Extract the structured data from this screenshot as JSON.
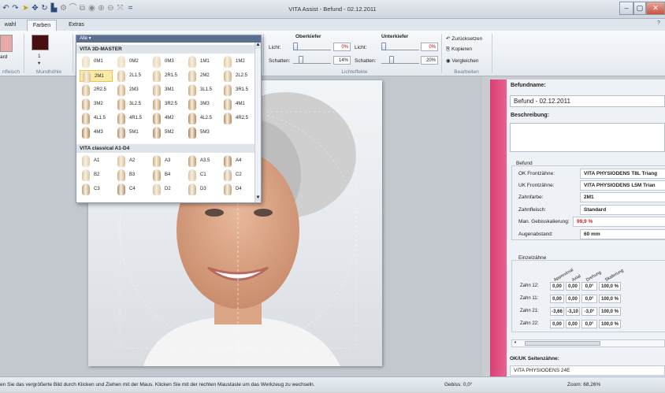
{
  "window": {
    "title": "VITA Assist - Befund - 02.12.2011",
    "buttons": {
      "minimize": "–",
      "maximize": "▢",
      "close": "✕"
    },
    "help_glyph": "?"
  },
  "quick_access": {
    "menu_glyph": "="
  },
  "tabs": [
    {
      "label": "wahl",
      "active": false
    },
    {
      "label": "Farben",
      "active": true
    },
    {
      "label": "Extras",
      "active": false
    }
  ],
  "ribbon": {
    "swatch_left_label": "ard",
    "mundhoehle_value": "1",
    "mundhoehle_arrow": "▾",
    "group_labels": {
      "left": "nfleisch",
      "mundhoehle": "Mundhöhle",
      "lichteffekte": "Lichteffekte",
      "bearbeiten": "Bearbeiten"
    },
    "oberkiefer": {
      "heading": "Oberkiefer",
      "licht_label": "Licht:",
      "licht_pct": "0%",
      "schatten_label": "Schatten:",
      "schatten_pct": "14%"
    },
    "unterkiefer": {
      "heading": "Unterkiefer",
      "licht_label": "Licht:",
      "licht_pct": "0%",
      "schatten_label": "Schatten:",
      "schatten_pct": "20%"
    },
    "bearbeiten": {
      "reset": "Zurücksetzen",
      "copy": "Kopieren",
      "compare": "Vergleichen"
    },
    "colors": {
      "swatch_gum": "#e7a8a8",
      "swatch_mouth": "#4a0e0e"
    }
  },
  "palette": {
    "header": "Alle ▾",
    "sections": [
      {
        "title": "VITA 3D-MASTER",
        "shades": [
          {
            "label": "0M1",
            "color": "#ecdcc3",
            "selected": false
          },
          {
            "label": "0M2",
            "color": "#eadac0",
            "selected": false
          },
          {
            "label": "0M3",
            "color": "#e6d4b8",
            "selected": false
          },
          {
            "label": "1M1",
            "color": "#e2cda8",
            "selected": false
          },
          {
            "label": "1M2",
            "color": "#e0c79c",
            "selected": false
          },
          {
            "label": "2M1",
            "color": "#dcc196",
            "selected": true
          },
          {
            "label": "2L1.5",
            "color": "#d9bc8f",
            "selected": false
          },
          {
            "label": "2R1.5",
            "color": "#d6b98d",
            "selected": false
          },
          {
            "label": "2M2",
            "color": "#d4b486",
            "selected": false
          },
          {
            "label": "2L2.5",
            "color": "#d2b07f",
            "selected": false
          },
          {
            "label": "2R2.5",
            "color": "#d0ad7d",
            "selected": false
          },
          {
            "label": "2M3",
            "color": "#cda877",
            "selected": false
          },
          {
            "label": "3M1",
            "color": "#cfae85",
            "selected": false
          },
          {
            "label": "3L1.5",
            "color": "#cba77b",
            "selected": false
          },
          {
            "label": "3R1.5",
            "color": "#c9a57a",
            "selected": false
          },
          {
            "label": "3M2",
            "color": "#c8a272",
            "selected": false
          },
          {
            "label": "3L2.5",
            "color": "#c59d6b",
            "selected": false
          },
          {
            "label": "3R2.5",
            "color": "#c39b6a",
            "selected": false
          },
          {
            "label": "3M3",
            "color": "#c09664",
            "selected": false
          },
          {
            "label": "4M1",
            "color": "#c29d77",
            "selected": false
          },
          {
            "label": "4L1.5",
            "color": "#bf986f",
            "selected": false
          },
          {
            "label": "4R1.5",
            "color": "#bd966e",
            "selected": false
          },
          {
            "label": "4M2",
            "color": "#ba9166",
            "selected": false
          },
          {
            "label": "4L2.5",
            "color": "#b78c5f",
            "selected": false
          },
          {
            "label": "4R2.5",
            "color": "#b58a5e",
            "selected": false
          },
          {
            "label": "4M3",
            "color": "#b28558",
            "selected": false
          },
          {
            "label": "5M1",
            "color": "#b48e6b",
            "selected": false
          },
          {
            "label": "5M2",
            "color": "#ae8661",
            "selected": false
          },
          {
            "label": "5M3",
            "color": "#a87e57",
            "selected": false
          }
        ]
      },
      {
        "title": "VITA classical A1-D4",
        "shades": [
          {
            "label": "A1",
            "color": "#e2cda8",
            "selected": false
          },
          {
            "label": "A2",
            "color": "#d9bc8f",
            "selected": false
          },
          {
            "label": "A3",
            "color": "#cda877",
            "selected": false
          },
          {
            "label": "A3.5",
            "color": "#c39b6a",
            "selected": false
          },
          {
            "label": "A4",
            "color": "#b5895b",
            "selected": false
          },
          {
            "label": "B2",
            "color": "#dcc49a",
            "selected": false
          },
          {
            "label": "B3",
            "color": "#cfae7f",
            "selected": false
          },
          {
            "label": "B4",
            "color": "#c7a173",
            "selected": false
          },
          {
            "label": "C1",
            "color": "#d8c2a0",
            "selected": false
          },
          {
            "label": "C2",
            "color": "#cbb28d",
            "selected": false
          },
          {
            "label": "C3",
            "color": "#bea27c",
            "selected": false
          },
          {
            "label": "C4",
            "color": "#ad8f69",
            "selected": false
          },
          {
            "label": "D2",
            "color": "#d6c2a2",
            "selected": false
          },
          {
            "label": "D3",
            "color": "#c9b28f",
            "selected": false
          },
          {
            "label": "D4",
            "color": "#c1a57e",
            "selected": false
          }
        ]
      }
    ]
  },
  "panel": {
    "befundname_label": "Befundname:",
    "befundname_value": "Befund - 02.12.2011",
    "beschreibung_label": "Beschreibung:",
    "beschreibung_value": "",
    "befund_heading": "Befund",
    "fields": [
      {
        "label": "OK Frontzähne:",
        "value": "VITA PHYSIODENS  T8L  Triang"
      },
      {
        "label": "UK Frontzähne:",
        "value": "VITA PHYSIODENS  L5M  Trian"
      },
      {
        "label": "Zahnfarbe:",
        "value": "2M1"
      },
      {
        "label": "Zahnfleisch:",
        "value": "Standard"
      },
      {
        "label": "Man. Gebisskalierung:",
        "value": "99,9 %",
        "value_color": "#d02020"
      },
      {
        "label": "Augenabstand:",
        "value": "60   mm"
      }
    ],
    "einzelzaehne_heading": "Einzelzähne",
    "einzel_columns": [
      "Approximal",
      "Axial",
      "Drehung",
      "Skalierung"
    ],
    "einzel_rows": [
      {
        "label": "Zahn 12:",
        "values": [
          "0,00",
          "0,00",
          "0,0°",
          "100,0 %"
        ]
      },
      {
        "label": "Zahn 11:",
        "values": [
          "0,00",
          "0,00",
          "0,0°",
          "100,0 %"
        ]
      },
      {
        "label": "Zahn 21:",
        "values": [
          "-3,66",
          "-3,10",
          "-3,0°",
          "100,0 %"
        ]
      },
      {
        "label": "Zahn 22:",
        "values": [
          "0,00",
          "0,00",
          "0,0°",
          "100,0 %"
        ]
      }
    ],
    "seitenzaehne_label": "OK/UK Seitenzähne:",
    "seitenzaehne_value": "VITA PHYSIODENS  24E"
  },
  "statusbar": {
    "hint": "en Sie das vergrößerte Bild durch Klicken und Ziehen mit der Maus. Klicken Sie mit der rechten Maustaste um das Werkzeug zu wechseln.",
    "gebiss": "Gebiss: 0,0°",
    "zoom": "Zoom: 68,26%"
  }
}
